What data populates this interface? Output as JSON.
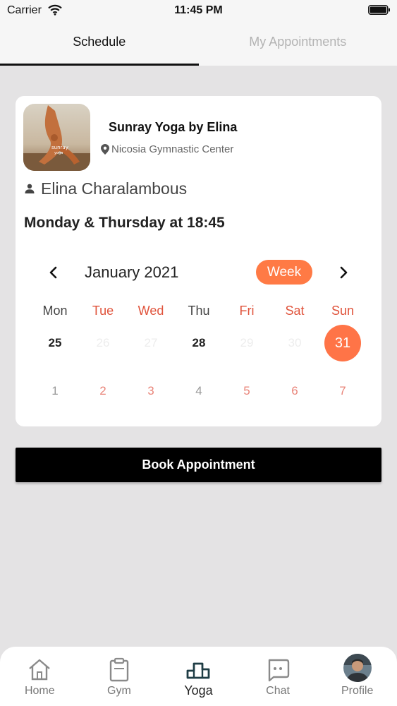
{
  "status_bar": {
    "carrier": "Carrier",
    "time": "11:45 PM"
  },
  "tabs": [
    {
      "label": "Schedule",
      "active": true
    },
    {
      "label": "My Appointments",
      "active": false
    }
  ],
  "class_card": {
    "title": "Sunray Yoga by Elina",
    "location": "Nicosia Gymnastic Center",
    "instructor": "Elina Charalambous",
    "schedule": "Monday & Thursday at 18:45"
  },
  "calendar": {
    "month": "January 2021",
    "view_button": "Week",
    "weekdays": [
      {
        "label": "Mon",
        "style": "normal"
      },
      {
        "label": "Tue",
        "style": "accent"
      },
      {
        "label": "Wed",
        "style": "accent"
      },
      {
        "label": "Thu",
        "style": "normal"
      },
      {
        "label": "Fri",
        "style": "accent"
      },
      {
        "label": "Sat",
        "style": "accent"
      },
      {
        "label": "Sun",
        "style": "accent"
      }
    ],
    "week1": [
      {
        "day": "25",
        "style": "bold"
      },
      {
        "day": "26",
        "style": "faded"
      },
      {
        "day": "27",
        "style": "faded"
      },
      {
        "day": "28",
        "style": "bold"
      },
      {
        "day": "29",
        "style": "faded"
      },
      {
        "day": "30",
        "style": "faded"
      },
      {
        "day": "31",
        "style": "selected"
      }
    ],
    "week2": [
      {
        "day": "1",
        "style": "grey"
      },
      {
        "day": "2",
        "style": "pink"
      },
      {
        "day": "3",
        "style": "pink"
      },
      {
        "day": "4",
        "style": "grey"
      },
      {
        "day": "5",
        "style": "pink"
      },
      {
        "day": "6",
        "style": "pink"
      },
      {
        "day": "7",
        "style": "pink"
      }
    ]
  },
  "book_button": "Book Appointment",
  "bottom_nav": [
    {
      "label": "Home",
      "icon": "home-icon",
      "active": false
    },
    {
      "label": "Gym",
      "icon": "clipboard-icon",
      "active": false
    },
    {
      "label": "Yoga",
      "icon": "podium-icon",
      "active": true
    },
    {
      "label": "Chat",
      "icon": "chat-icon",
      "active": false
    },
    {
      "label": "Profile",
      "icon": "avatar",
      "active": false
    }
  ],
  "colors": {
    "accent": "#ff7a45",
    "weekday_accent": "#e0533b",
    "background": "#e4e3e4"
  }
}
